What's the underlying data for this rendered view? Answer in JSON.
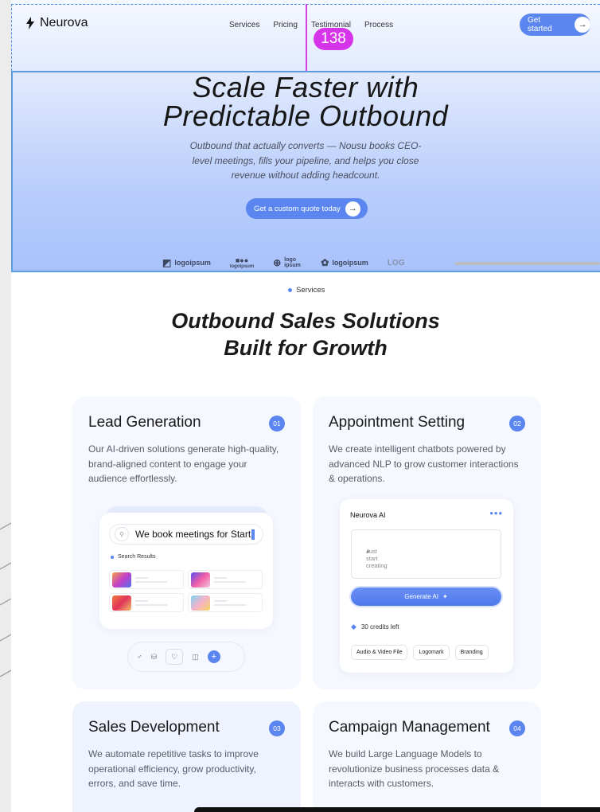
{
  "header": {
    "brand": "Neurova",
    "nav": [
      "Services",
      "Pricing",
      "Testimonial",
      "Process"
    ],
    "cta_label": "Get started",
    "measure_value": "138"
  },
  "hero": {
    "title_line1": "Scale Faster with",
    "title_line2": "Predictable Outbound",
    "subtitle": "Outbound that actually converts — Nousu books CEO-level meetings, fills your pipeline, and helps you close revenue without adding headcount.",
    "cta_label": "Get a custom quote today",
    "logos": [
      "logoipsum",
      "logoipsum",
      "logo ipsum",
      "logoipsum",
      "LOG"
    ]
  },
  "services": {
    "tag": "Services",
    "title": "Outbound Sales Solutions Built for Growth",
    "cards": [
      {
        "title": "Lead Generation",
        "num": "01",
        "text": "Our AI-driven solutions generate high-quality, brand-aligned content to engage your audience effortlessly."
      },
      {
        "title": "Appointment Setting",
        "num": "02",
        "text": "We create intelligent chatbots powered by advanced NLP to grow customer interactions & operations."
      },
      {
        "title": "Sales Development",
        "num": "03",
        "text": "We automate repetitive tasks to improve operational efficiency, grow productivity, errors, and save time."
      },
      {
        "title": "Campaign Management",
        "num": "04",
        "text": "We build Large Language Models to revolutionize business processes data & interacts with customers."
      }
    ]
  },
  "search_widget": {
    "query": "We book meetings for Start",
    "results_label": "Search Results"
  },
  "ai_widget": {
    "title": "Neurova AI",
    "placeholder": "Just start creating",
    "button": "Generate AI",
    "credits": "30 credits left",
    "chips": [
      "Audio & Video File",
      "Logomark",
      "Branding"
    ]
  },
  "colors": {
    "accent": "#5b86f0",
    "guide": "#d634e8"
  }
}
